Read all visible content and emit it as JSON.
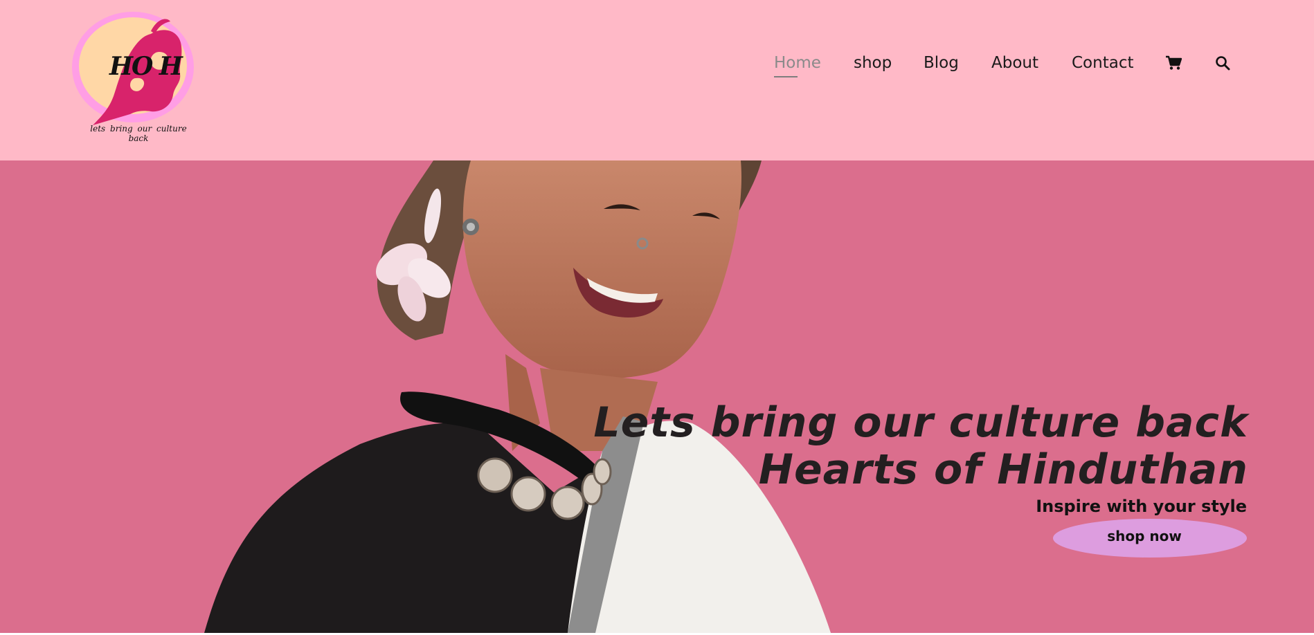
{
  "logo": {
    "text": "HO H",
    "tagline": "lets bring our culture back"
  },
  "nav": {
    "items": [
      "Home",
      "shop",
      "Blog",
      "About",
      "Contact"
    ],
    "active": "Home",
    "cart_icon": "cart-icon",
    "search_icon": "search-icon"
  },
  "hero": {
    "title_line1": "Lets bring our culture back",
    "title_line2": "Hearts of Hinduthan",
    "subtitle": "Inspire with your style",
    "cta_label": "shop now"
  },
  "colors": {
    "header_bg": "#ffb9c7",
    "hero_bg": "#db6e8d",
    "button_bg": "#dd9ddf",
    "text_dark": "#231f20",
    "nav_active": "#8a8a8a"
  }
}
